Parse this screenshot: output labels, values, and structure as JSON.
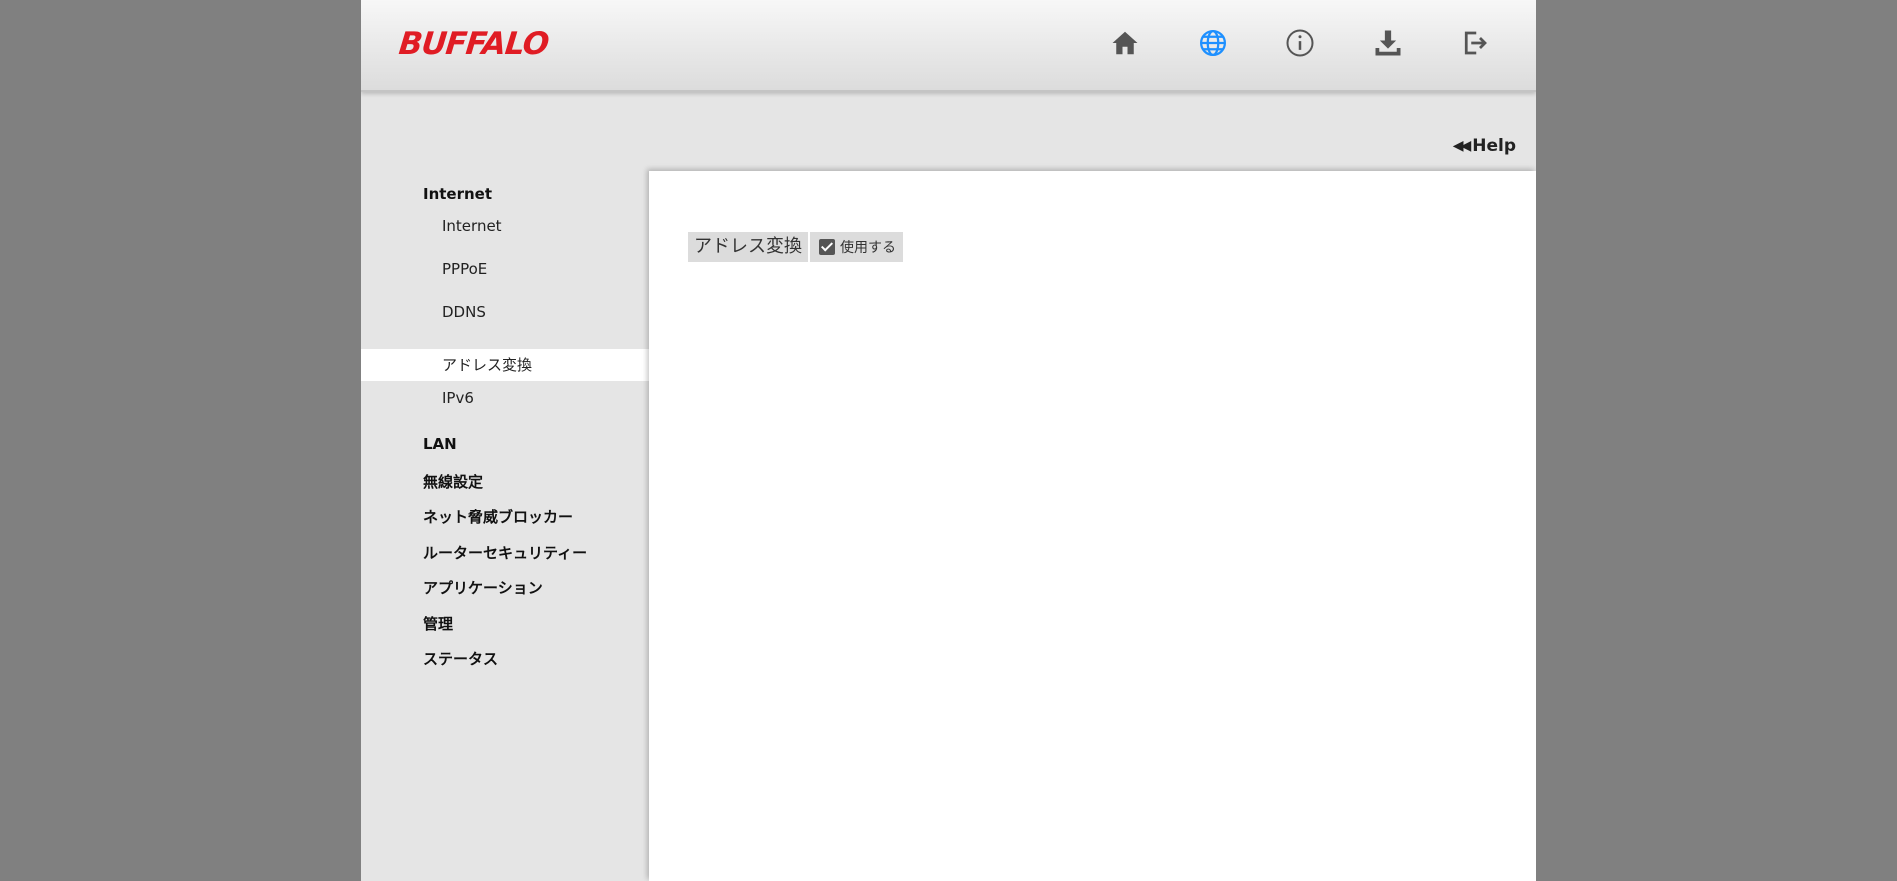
{
  "header": {
    "logo": "BUFFALO",
    "icons": [
      {
        "name": "home-icon",
        "active": false
      },
      {
        "name": "globe-icon",
        "active": true
      },
      {
        "name": "info-icon",
        "active": false
      },
      {
        "name": "download-icon",
        "active": false
      },
      {
        "name": "logout-icon",
        "active": false
      }
    ],
    "accent_color": "#1e90ff",
    "icon_color": "#555555"
  },
  "help": {
    "label": "Help"
  },
  "sidebar": {
    "categories": {
      "internet": "Internet",
      "lan": "LAN",
      "wireless": "無線設定",
      "threat_blocker": "ネット脅威ブロッカー",
      "router_security": "ルーターセキュリティー",
      "application": "アプリケーション",
      "management": "管理",
      "status": "ステータス"
    },
    "internet_items": [
      {
        "label": "Internet",
        "active": false
      },
      {
        "label": "PPPoE",
        "active": false
      },
      {
        "label": "DDNS",
        "active": false
      },
      {
        "label": "アドレス変換",
        "active": true
      },
      {
        "label": "IPv6",
        "active": false
      }
    ]
  },
  "main": {
    "setting_label": "アドレス変換",
    "checkbox_label": "使用する",
    "checkbox_checked": true
  },
  "colors": {
    "brand": "#e01c24"
  }
}
